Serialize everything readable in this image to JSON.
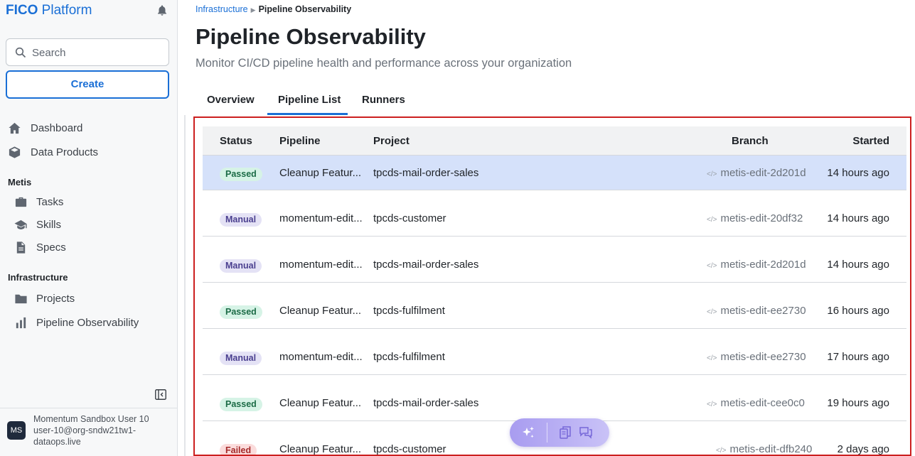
{
  "brand": {
    "bold": "FICO",
    "rest": " Platform"
  },
  "search": {
    "placeholder": "Search"
  },
  "create_label": "Create",
  "nav": {
    "dashboard": "Dashboard",
    "data_products": "Data Products",
    "metis_section": "Metis",
    "tasks": "Tasks",
    "skills": "Skills",
    "specs": "Specs",
    "infra_section": "Infrastructure",
    "projects": "Projects",
    "pipeline_observability": "Pipeline Observability"
  },
  "user": {
    "initials": "MS",
    "name": "Momentum Sandbox User 10",
    "email": "user-10@org-sndw21tw1-dataops.live"
  },
  "breadcrumb": {
    "parent": "Infrastructure",
    "current": "Pipeline Observability"
  },
  "page": {
    "title": "Pipeline Observability",
    "subtitle": "Monitor CI/CD pipeline health and performance across your organization"
  },
  "tabs": {
    "overview": "Overview",
    "pipeline_list": "Pipeline List",
    "runners": "Runners"
  },
  "table": {
    "headers": {
      "status": "Status",
      "pipeline": "Pipeline",
      "project": "Project",
      "branch": "Branch",
      "started": "Started"
    },
    "rows": [
      {
        "status": "Passed",
        "pipeline": "Cleanup Featur...",
        "project": "tpcds-mail-order-sales",
        "branch": "metis-edit-2d201d",
        "started": "14 hours ago"
      },
      {
        "status": "Manual",
        "pipeline": "momentum-edit...",
        "project": "tpcds-customer",
        "branch": "metis-edit-20df32",
        "started": "14 hours ago"
      },
      {
        "status": "Manual",
        "pipeline": "momentum-edit...",
        "project": "tpcds-mail-order-sales",
        "branch": "metis-edit-2d201d",
        "started": "14 hours ago"
      },
      {
        "status": "Passed",
        "pipeline": "Cleanup Featur...",
        "project": "tpcds-fulfilment",
        "branch": "metis-edit-ee2730",
        "started": "16 hours ago"
      },
      {
        "status": "Manual",
        "pipeline": "momentum-edit...",
        "project": "tpcds-fulfilment",
        "branch": "metis-edit-ee2730",
        "started": "17 hours ago"
      },
      {
        "status": "Passed",
        "pipeline": "Cleanup Featur...",
        "project": "tpcds-mail-order-sales",
        "branch": "metis-edit-cee0c0",
        "started": "19 hours ago"
      },
      {
        "status": "Failed",
        "pipeline": "Cleanup Featur...",
        "project": "tpcds-customer",
        "branch": "metis-edit-dfb240",
        "started": "2 days ago"
      }
    ]
  },
  "colors": {
    "accent": "#1a6fd6",
    "selected_row": "#d5e1fa",
    "highlight_border": "#cc1f1f"
  },
  "icons": [
    "bell-icon",
    "search-icon",
    "home-icon",
    "cube-icon",
    "briefcase-icon",
    "graduation-cap-icon",
    "document-icon",
    "folder-icon",
    "bar-chart-icon",
    "sidebar-collapse-icon",
    "branch-code-icon",
    "sparkle-icon",
    "copy-icon",
    "chat-icon"
  ]
}
